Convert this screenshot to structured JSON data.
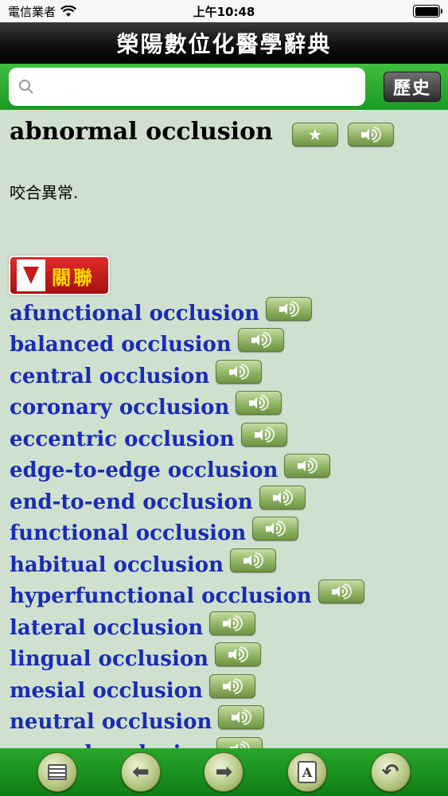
{
  "status_bar": {
    "carrier": "電信業者",
    "time": "上午10:48"
  },
  "header": {
    "title": "榮陽數位化醫學辭典"
  },
  "search": {
    "placeholder": "",
    "value": "",
    "history_label": "歷史"
  },
  "entry": {
    "headword": "abnormal occlusion",
    "definition": "咬合異常."
  },
  "related": {
    "label": "關聯",
    "items": [
      "afunctional occlusion",
      "balanced occlusion",
      "central occlusion",
      "coronary occlusion",
      "eccentric occlusion",
      "edge-to-edge occlusion",
      "end-to-end occlusion",
      "functional occlusion",
      "habitual occlusion",
      "hyperfunctional occlusion",
      "lateral occlusion",
      "lingual occlusion",
      "mesial occlusion",
      "neutral occlusion",
      "normal occlusion"
    ]
  },
  "toolbar": {
    "buttons": [
      "list-icon",
      "arrow-left-icon",
      "arrow-right-icon",
      "address-book-icon",
      "undo-icon"
    ]
  },
  "colors": {
    "background": "#cfe0cf",
    "toolbar": "#1b9a22",
    "link": "#1a2bb5",
    "related_tag": "#c41b1b"
  }
}
